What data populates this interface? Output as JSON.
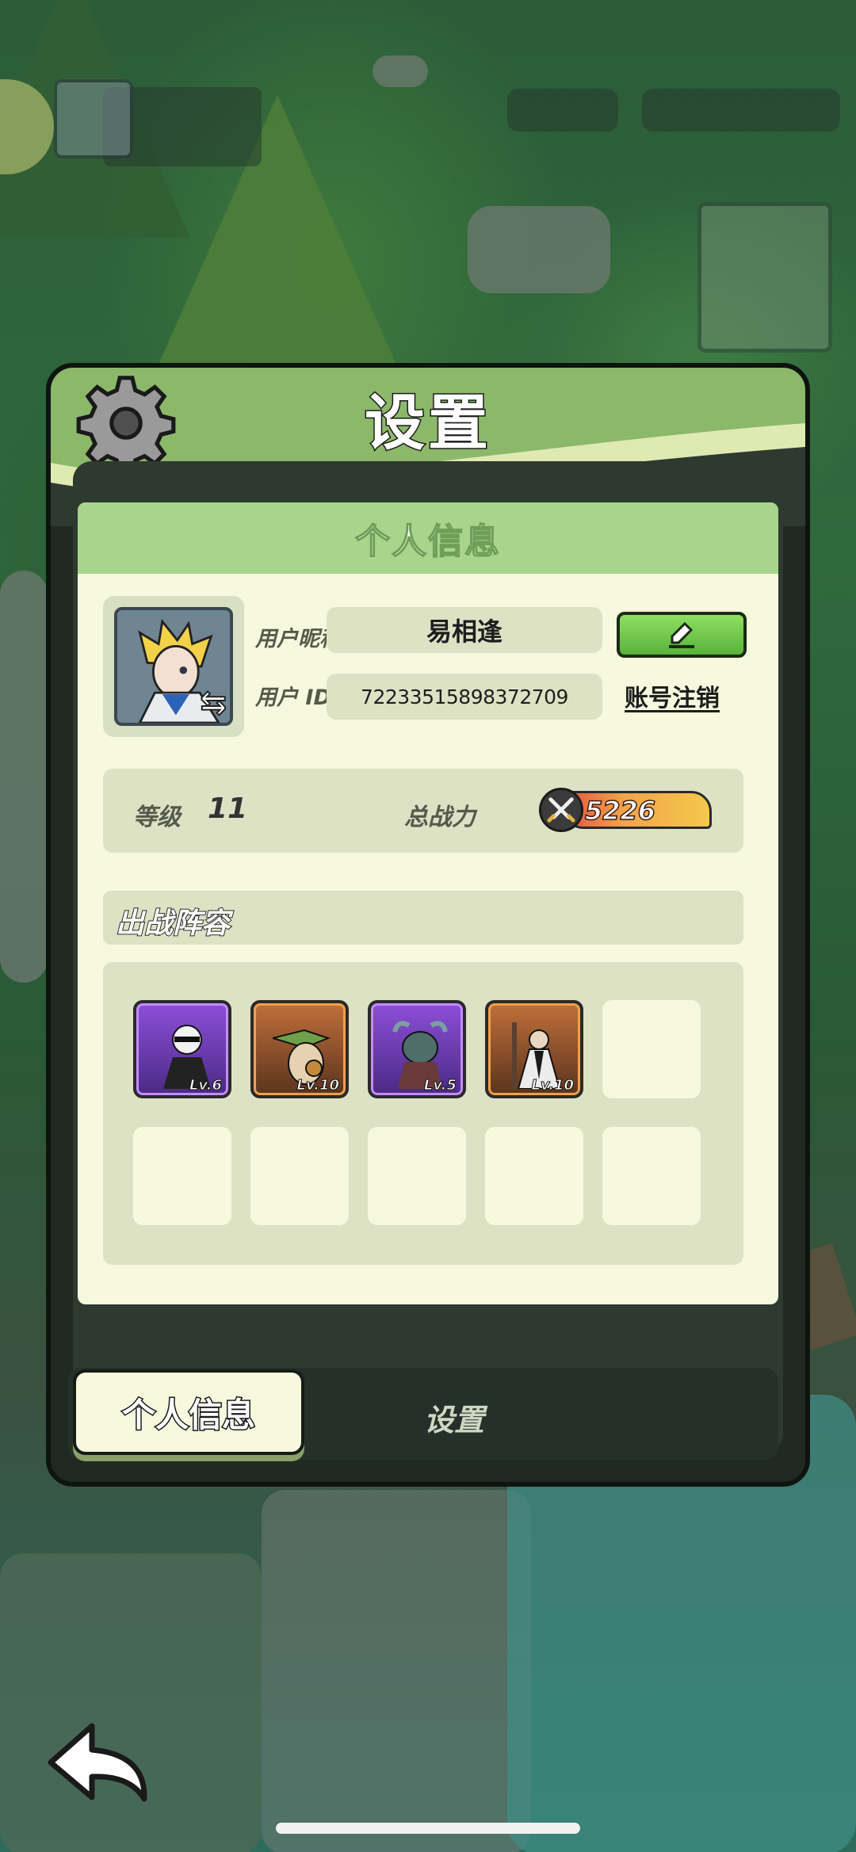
{
  "dialog": {
    "title": "设置"
  },
  "profile": {
    "section_title": "个人信息",
    "nickname_label": "用户昵称",
    "nickname": "易相逢",
    "id_label": "用户 ID",
    "user_id": "72233515898372709",
    "account_cancel_link": "账号注销"
  },
  "stats": {
    "level_label": "等级",
    "level": "11",
    "power_label": "总战力",
    "power": "5226"
  },
  "lineup": {
    "title": "出战阵容",
    "heroes": [
      {
        "level": "Lv.6",
        "rarity": "purple"
      },
      {
        "level": "Lv.10",
        "rarity": "orange"
      },
      {
        "level": "Lv.5",
        "rarity": "purple"
      },
      {
        "level": "Lv.10",
        "rarity": "orange"
      }
    ]
  },
  "tabs": {
    "personal": "个人信息",
    "settings": "设置"
  },
  "colors": {
    "header_green": "#8cb86a",
    "card_bg": "#f6f9dd",
    "edit_button": "#58b23a",
    "purple_rarity": "#8d4fd8",
    "orange_rarity": "#c1703a"
  }
}
